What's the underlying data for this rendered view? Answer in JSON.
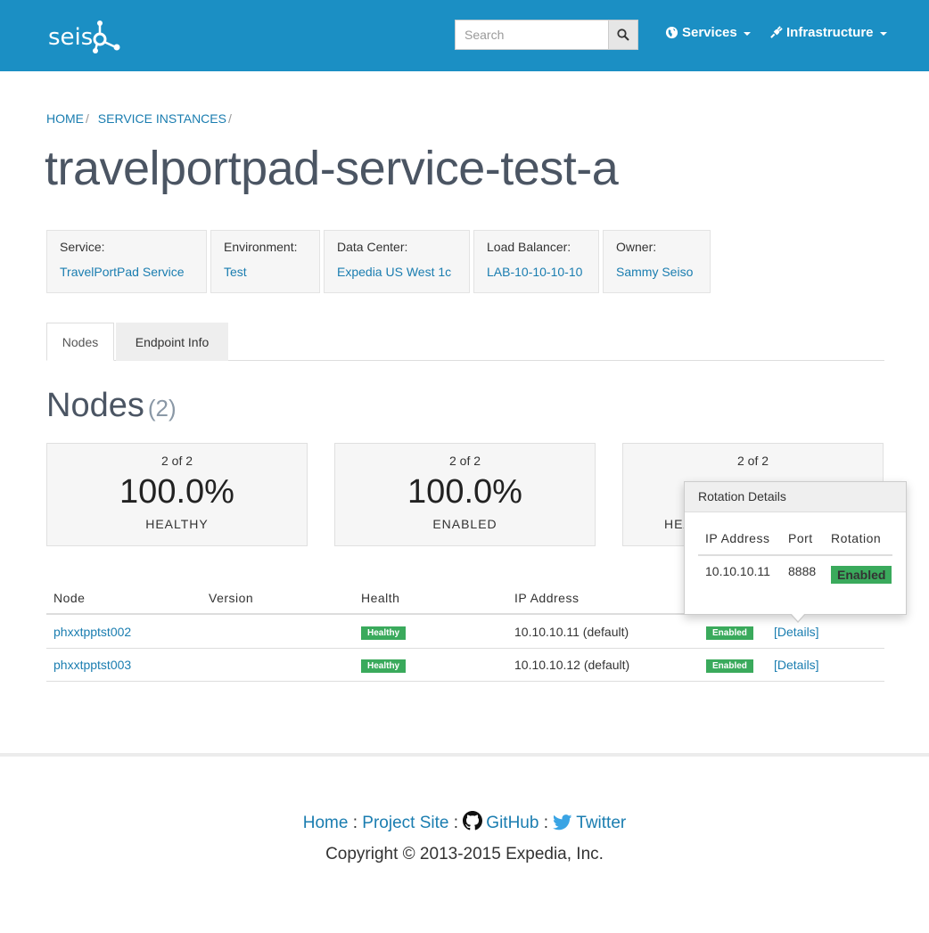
{
  "navbar": {
    "logo_text": "seis",
    "search_placeholder": "Search",
    "services_label": "Services",
    "infrastructure_label": "Infrastructure",
    "color": "#1b8fc4"
  },
  "breadcrumb": {
    "home": "HOME",
    "sep1": "/",
    "service_instances": "SERVICE INSTANCES",
    "sep2": "/"
  },
  "page_title": "travelportpad-service-test-a",
  "info": [
    {
      "label": "Service:",
      "value": "TravelPortPad Service"
    },
    {
      "label": "Environment:",
      "value": "Test"
    },
    {
      "label": "Data Center:",
      "value": "Expedia US West 1c"
    },
    {
      "label": "Load Balancer:",
      "value": "LAB-10-10-10-10"
    },
    {
      "label": "Owner:",
      "value": "Sammy Seiso"
    }
  ],
  "tabs": [
    {
      "label": "Nodes",
      "active": true
    },
    {
      "label": "Endpoint Info",
      "active": false
    }
  ],
  "nodes_heading": {
    "title": "Nodes",
    "count": "(2)"
  },
  "stats": [
    {
      "ratio": "2 of 2",
      "percent": "100.0%",
      "caption": "HEALTHY"
    },
    {
      "ratio": "2 of 2",
      "percent": "100.0%",
      "caption": "ENABLED"
    },
    {
      "ratio": "2 of 2",
      "percent": "",
      "caption": "HEA"
    }
  ],
  "table": {
    "headers": [
      "Node",
      "Version",
      "Health",
      "IP Address"
    ],
    "rows": [
      {
        "node": "phxxtpptst002",
        "version": "",
        "health": "Healthy",
        "ip": "10.10.10.11 (default)",
        "rotation": "Enabled",
        "details": "[Details]"
      },
      {
        "node": "phxxtpptst003",
        "version": "",
        "health": "Healthy",
        "ip": "10.10.10.12 (default)",
        "rotation": "Enabled",
        "details": "[Details]"
      }
    ]
  },
  "popover": {
    "title": "Rotation Details",
    "headers": [
      "IP Address",
      "Port",
      "Rotation"
    ],
    "row": {
      "ip": "10.10.10.11",
      "port": "8888",
      "rotation": "Enabled"
    }
  },
  "footer": {
    "home": "Home",
    "sep1": ":",
    "project_site": "Project Site",
    "sep2": ":",
    "github": "GitHub",
    "sep3": ":",
    "twitter": "Twitter",
    "copyright": "Copyright © 2013-2015 Expedia, Inc."
  },
  "colors": {
    "link": "#1a7db0",
    "badge_green": "#3aaa5c"
  }
}
